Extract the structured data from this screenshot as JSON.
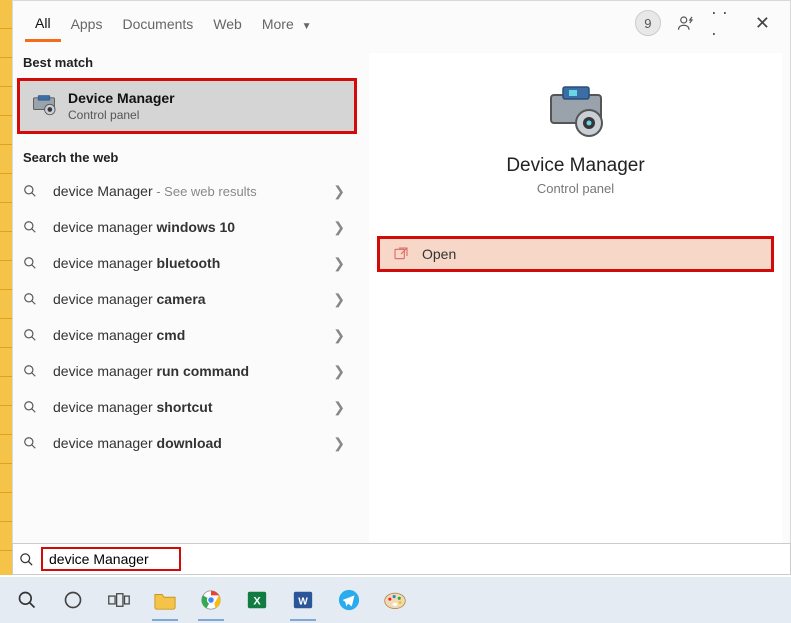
{
  "tabs": {
    "all": "All",
    "apps": "Apps",
    "documents": "Documents",
    "web": "Web",
    "more": "More"
  },
  "header": {
    "badge_count": "9"
  },
  "sections": {
    "best_match": "Best match",
    "search_web": "Search the web"
  },
  "best_match": {
    "title": "Device Manager",
    "subtitle": "Control panel"
  },
  "web_results": [
    {
      "base": "device Manager",
      "bold": "",
      "hint": " - See web results"
    },
    {
      "base": "device manager ",
      "bold": "windows 10",
      "hint": ""
    },
    {
      "base": "device manager ",
      "bold": "bluetooth",
      "hint": ""
    },
    {
      "base": "device manager ",
      "bold": "camera",
      "hint": ""
    },
    {
      "base": "device manager ",
      "bold": "cmd",
      "hint": ""
    },
    {
      "base": "device manager ",
      "bold": "run command",
      "hint": ""
    },
    {
      "base": "device manager ",
      "bold": "shortcut",
      "hint": ""
    },
    {
      "base": "device manager ",
      "bold": "download",
      "hint": ""
    }
  ],
  "detail": {
    "title": "Device Manager",
    "subtitle": "Control panel"
  },
  "action": {
    "open": "Open"
  },
  "search": {
    "query": "device Manager"
  }
}
